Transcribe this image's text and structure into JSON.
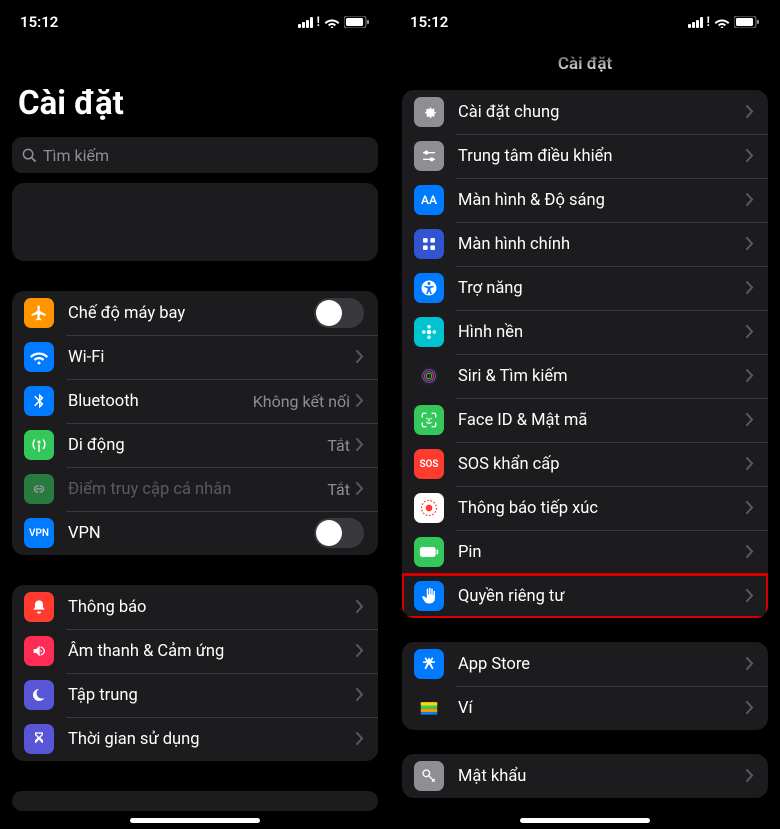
{
  "status": {
    "time": "15:12",
    "signal_exclaim": "!"
  },
  "left": {
    "title": "Cài đặt",
    "search_placeholder": "Tìm kiếm",
    "group_network": {
      "airplane": "Chế độ máy bay",
      "wifi": "Wi-Fi",
      "bluetooth": "Bluetooth",
      "bluetooth_value": "Không kết nối",
      "cellular": "Di động",
      "cellular_value": "Tắt",
      "hotspot": "Điểm truy cập cá nhân",
      "hotspot_value": "Tắt",
      "vpn": "VPN"
    },
    "group_personal": {
      "notifications": "Thông báo",
      "sounds": "Âm thanh & Cảm ứng",
      "focus": "Tập trung",
      "screentime": "Thời gian sử dụng"
    }
  },
  "right": {
    "nav_title": "Cài đặt",
    "group_main": {
      "general": "Cài đặt chung",
      "control_center": "Trung tâm điều khiển",
      "display": "Màn hình & Độ sáng",
      "home_screen": "Màn hình chính",
      "accessibility": "Trợ năng",
      "wallpaper": "Hình nền",
      "siri": "Siri & Tìm kiếm",
      "faceid": "Face ID & Mật mã",
      "sos": "SOS khẩn cấp",
      "exposure": "Thông báo tiếp xúc",
      "battery": "Pin",
      "privacy": "Quyền riêng tư"
    },
    "group_store": {
      "appstore": "App Store",
      "wallet": "Ví"
    },
    "group_last": {
      "passwords": "Mật khẩu"
    }
  },
  "icon_text": {
    "AA": "AA",
    "SOS": "SOS",
    "VPN": "VPN"
  },
  "colors": {
    "orange": "#ff9500",
    "blue": "#007aff",
    "green": "#34c759",
    "green2": "#30d158",
    "red": "#ff3b30",
    "pink": "#ff2d55",
    "purple": "#5856d6",
    "gray": "#8e8e93",
    "darkblue": "#0a5fd9",
    "black": "#1c1c1e",
    "white": "#ffffff"
  }
}
